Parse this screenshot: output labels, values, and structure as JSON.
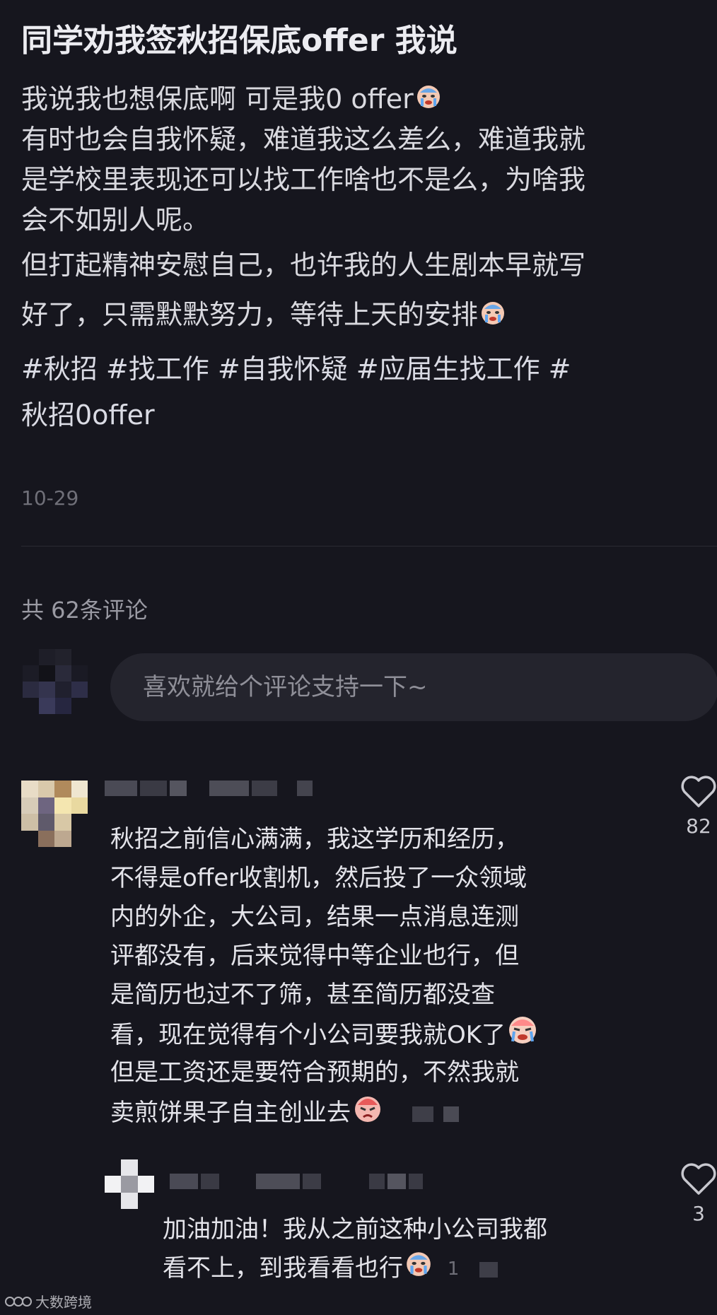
{
  "post": {
    "title": "同学劝我签秋招保底offer 我说",
    "lines": [
      "我说我也想保底啊 可是我0 offer",
      "有时也会自我怀疑，难道我这么差么，难道我就",
      "是学校里表现还可以找工作啥也不是么，为啥我",
      "会不如别人呢。",
      "但打起精神安慰自己，也许我的人生剧本早就写",
      "好了，只需默默努力，等待上天的安排"
    ],
    "hashtags_line1": "#秋招 #找工作 #自我怀疑 #应届生找工作 #",
    "hashtags_line2": "秋招0offer",
    "date": "10-29"
  },
  "comments_header": {
    "count_text": "共 62条评论"
  },
  "comment_input": {
    "placeholder": "喜欢就给个评论支持一下~"
  },
  "comments": [
    {
      "likes": "82",
      "lines": [
        "秋招之前信心满满，我这学历和经历，",
        "不得是offer收割机，然后投了一众领域",
        "内的外企，大公司，结果一点消息连测",
        "评都没有，后来觉得中等企业也行，但",
        "是简历也过不了筛，甚至简历都没查",
        "看，现在觉得有个小公司要我就OK了",
        "但是工资还是要符合预期的，不然我就",
        "卖煎饼果子自主创业去"
      ],
      "emojis": [
        "crying-face-emoji",
        "pouting-face-emoji"
      ]
    }
  ],
  "reply": {
    "likes": "3",
    "lines": [
      "加油加油！我从之前这种小公司我都",
      "看不上，到我看看也行"
    ],
    "reply_count": "1"
  },
  "watermark": {
    "text": "大数跨境"
  },
  "colors": {
    "background": "#16161e",
    "text": "#d9d9df",
    "muted": "#6f6f78",
    "input_bg": "#24242d"
  }
}
